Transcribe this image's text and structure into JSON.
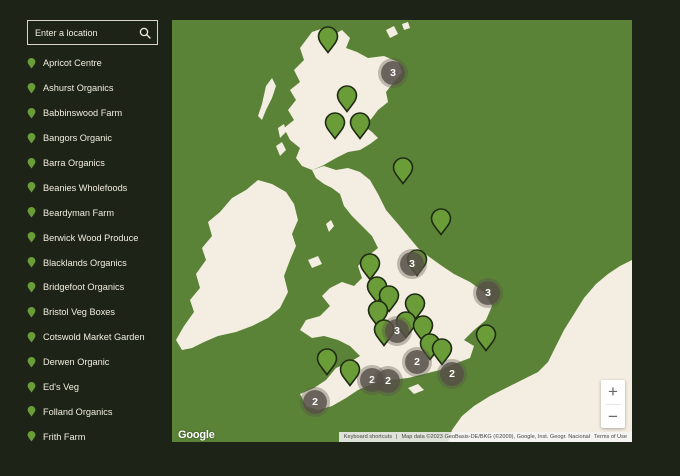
{
  "search": {
    "placeholder": "Enter a location",
    "icon": "search-icon"
  },
  "locations": [
    "Apricot Centre",
    "Ashurst Organics",
    "Babbinswood Farm",
    "Bangors Organic",
    "Barra Organics",
    "Beanies Wholefoods",
    "Beardyman Farm",
    "Berwick Wood Produce",
    "Blacklands Organics",
    "Bridgefoot Organics",
    "Bristol Veg Boxes",
    "Cotswold Market Garden",
    "Derwen Organic",
    "Ed's Veg",
    "Folland Organics",
    "Frith Farm"
  ],
  "clusters": [
    {
      "label": "3"
    },
    {
      "label": "3"
    },
    {
      "label": "3"
    },
    {
      "label": "2"
    },
    {
      "label": "2"
    },
    {
      "label": "2"
    },
    {
      "label": "2"
    },
    {
      "label": "2"
    }
  ],
  "map": {
    "zoom_in": "+",
    "zoom_out": "−",
    "logo": "Google",
    "keyboard_shortcuts": "Keyboard shortcuts",
    "map_data": "Map data ©2023 GeoBasis-DE/BKG (©2009), Google, Inst. Geogr. Nacional",
    "terms": "Terms of Use"
  },
  "colors": {
    "background": "#1d2417",
    "sea": "#5b8337",
    "land": "#f4ede1",
    "pin": "#6a9c37",
    "cluster": "#565048"
  }
}
